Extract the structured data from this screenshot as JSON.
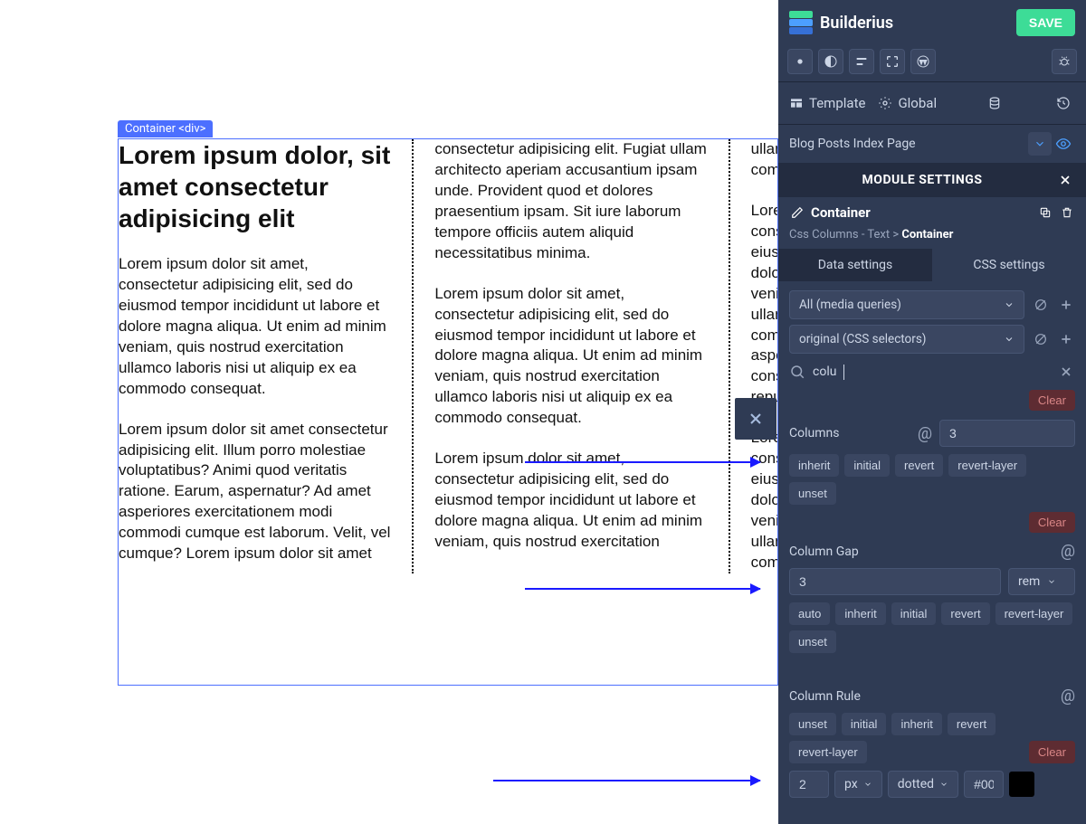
{
  "header": {
    "brand": "Builderius",
    "save": "SAVE",
    "template": "Template",
    "global": "Global",
    "page_name": "Blog Posts Index Page"
  },
  "selection": {
    "label": "Container <div>"
  },
  "content": {
    "heading": "Lorem ipsum dolor, sit amet consectetur adipisicing elit",
    "p1": "Lorem ipsum dolor sit amet, consectetur adipisicing elit, sed do eiusmod tempor incididunt ut labore et dolore magna aliqua. Ut enim ad minim veniam, quis nostrud exercitation ullamco laboris nisi ut aliquip ex ea commodo consequat.",
    "p2": "Lorem ipsum dolor sit amet consectetur adipisicing elit. Illum porro molestiae voluptatibus? Animi quod veritatis ratione. Earum, aspernatur? Ad amet asperiores exercitationem modi commodi cumque est laborum. Velit, vel cumque? Lorem ipsum dolor sit amet consectetur adipisicing elit. Fugiat ullam architecto aperiam accusantium ipsam unde. Provident quod et dolores praesentium ipsam. Sit iure laborum tempore officiis autem aliquid necessitatibus minima.",
    "p3": "Lorem ipsum dolor sit amet, consectetur adipisicing elit, sed do eiusmod tempor incididunt ut labore et dolore magna aliqua. Ut enim ad minim veniam, quis nostrud exercitation ullamco laboris nisi ut aliquip ex ea commodo consequat.",
    "p4": "Lorem ipsum dolor sit amet, consectetur adipisicing elit, sed do eiusmod tempor incididunt ut labore et dolore magna aliqua. Ut enim ad minim veniam, quis nostrud exercitation ullamco laboris nisi ut aliquip ex ea commodo consequat.",
    "p5": "Lorem ipsum dolor sit amet, consectetur adipisicing elit, sed do eiusmod tempor incididunt ut labore et dolore magna aliqua. Ut enim ad minim veniam, quis nostrud exercitation ullamco laboris nisi ut aliquip ex ea commodo consequat. Maiores asperiores elit. Ullam impedit qui consectetur. Nemo consectetur repudiandae autem obcaecati.",
    "p6": "Lorem ipsum dolor sit amet, consectetur adipisicing elit, sed do eiusmod tempor incididunt ut labore et dolore magna aliqua. Ut enim ad minim veniam, quis nostrud exercitation ullamco laboris nisi ut aliquip ex ea commodo."
  },
  "module": {
    "settings_title": "MODULE SETTINGS",
    "name": "Container",
    "breadcrumb_pre": "Css Columns - Text > ",
    "breadcrumb_cur": "Container",
    "tab_data": "Data settings",
    "tab_css": "CSS settings",
    "media_query": "All (media queries)",
    "css_selector": "original (CSS selectors)",
    "search_value": "colu",
    "clear": "Clear"
  },
  "props": {
    "columns": {
      "label": "Columns",
      "value": "3"
    },
    "columns_tokens": [
      "inherit",
      "initial",
      "revert",
      "revert-layer",
      "unset"
    ],
    "gap": {
      "label": "Column Gap",
      "value": "3",
      "unit": "rem"
    },
    "gap_tokens": [
      "auto",
      "inherit",
      "initial",
      "revert",
      "revert-layer",
      "unset"
    ],
    "rule": {
      "label": "Column Rule",
      "width": "2",
      "unit": "px",
      "style": "dotted",
      "color": "#000000"
    },
    "rule_tokens": [
      "unset",
      "initial",
      "inherit",
      "revert",
      "revert-layer"
    ]
  }
}
